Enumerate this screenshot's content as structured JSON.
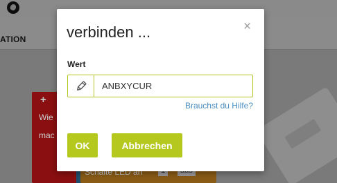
{
  "app": {
    "nav_label": "ATION",
    "block_text_1": "Wie",
    "block_text_2": "mac",
    "block_add_glyph": "+",
    "block_text_3": "Schalte LED an",
    "chip_value_1": "1",
    "chip_value_2": "aus"
  },
  "dialog": {
    "title": "verbinden ...",
    "close_glyph": "×",
    "field_label": "Wert",
    "input_value": "ANBXYCUR",
    "input_icon": "pencil-icon",
    "help_link": "Brauchst du Hilfe?",
    "ok_label": "OK",
    "cancel_label": "Abbrechen"
  },
  "colors": {
    "accent": "#b4c81e",
    "link": "#4a8ec1",
    "overlay_background": "#7d7d7d",
    "block_red": "#8a0f10",
    "block_orange": "#8a5c16"
  }
}
